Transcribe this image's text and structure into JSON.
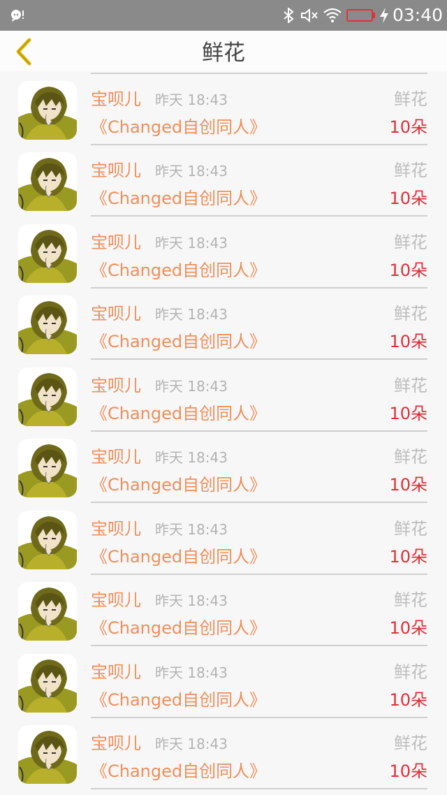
{
  "status_bar": {
    "time": "03:40",
    "icons": [
      "notification-icon",
      "bluetooth-icon",
      "mute-icon",
      "wifi-icon",
      "battery-icon",
      "charging-icon"
    ],
    "battery_color": "#e0303a"
  },
  "header": {
    "title": "鲜花",
    "back_icon": "chevron-left-icon",
    "back_color": "#e0b800"
  },
  "colors": {
    "accent_name": "#ef8f5b",
    "count_red": "#e0303a",
    "meta_gray": "#b3b3b3"
  },
  "records": [
    {
      "name": "宝呗儿",
      "time": "昨天 18:43",
      "type": "鲜花",
      "work": "《Changed自创同人》",
      "count": "10朵"
    },
    {
      "name": "宝呗儿",
      "time": "昨天 18:43",
      "type": "鲜花",
      "work": "《Changed自创同人》",
      "count": "10朵"
    },
    {
      "name": "宝呗儿",
      "time": "昨天 18:43",
      "type": "鲜花",
      "work": "《Changed自创同人》",
      "count": "10朵"
    },
    {
      "name": "宝呗儿",
      "time": "昨天 18:43",
      "type": "鲜花",
      "work": "《Changed自创同人》",
      "count": "10朵"
    },
    {
      "name": "宝呗儿",
      "time": "昨天 18:43",
      "type": "鲜花",
      "work": "《Changed自创同人》",
      "count": "10朵"
    },
    {
      "name": "宝呗儿",
      "time": "昨天 18:43",
      "type": "鲜花",
      "work": "《Changed自创同人》",
      "count": "10朵"
    },
    {
      "name": "宝呗儿",
      "time": "昨天 18:43",
      "type": "鲜花",
      "work": "《Changed自创同人》",
      "count": "10朵"
    },
    {
      "name": "宝呗儿",
      "time": "昨天 18:43",
      "type": "鲜花",
      "work": "《Changed自创同人》",
      "count": "10朵"
    },
    {
      "name": "宝呗儿",
      "time": "昨天 18:43",
      "type": "鲜花",
      "work": "《Changed自创同人》",
      "count": "10朵"
    },
    {
      "name": "宝呗儿",
      "time": "昨天 18:43",
      "type": "鲜花",
      "work": "《Changed自创同人》",
      "count": "10朵"
    }
  ]
}
